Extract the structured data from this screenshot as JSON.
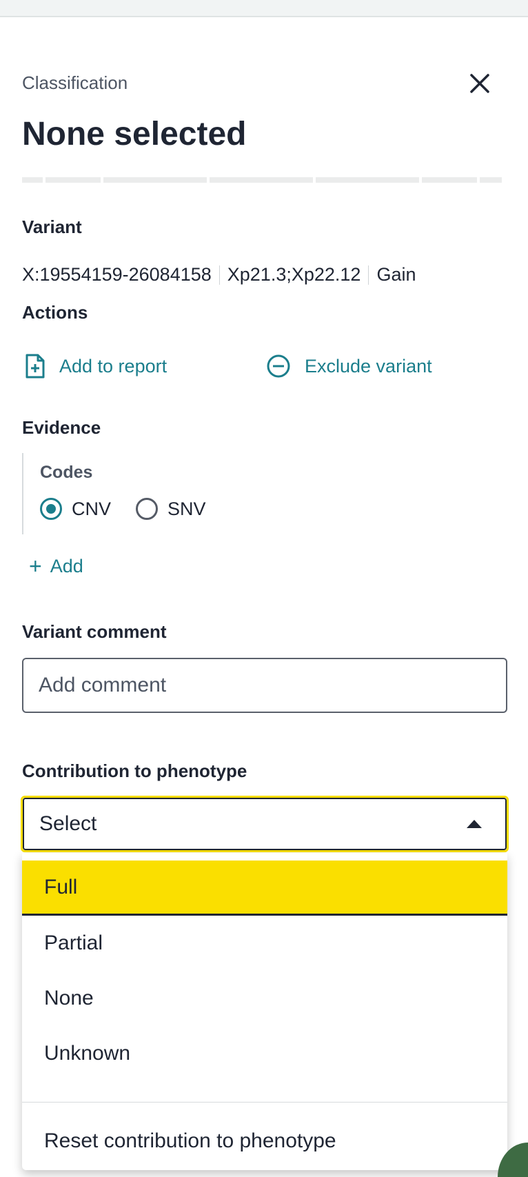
{
  "panel": {
    "eyebrow": "Classification",
    "title": "None selected",
    "close_icon": "close-icon"
  },
  "variant": {
    "label": "Variant",
    "coordinates": "X:19554159-26084158",
    "cytoband": "Xp21.3;Xp22.12",
    "type": "Gain"
  },
  "actions": {
    "label": "Actions",
    "add_to_report": "Add to report",
    "exclude_variant": "Exclude variant"
  },
  "evidence": {
    "label": "Evidence",
    "codes_label": "Codes",
    "options": [
      {
        "label": "CNV",
        "selected": true
      },
      {
        "label": "SNV",
        "selected": false
      }
    ],
    "add_label": "Add"
  },
  "comment": {
    "label": "Variant comment",
    "placeholder": "Add comment",
    "value": ""
  },
  "contribution": {
    "label": "Contribution to phenotype",
    "selected": "Select",
    "options": [
      "Full",
      "Partial",
      "None",
      "Unknown"
    ],
    "highlighted": "Full",
    "reset_label": "Reset contribution to phenotype"
  },
  "colors": {
    "accent": "#1b7e8c",
    "highlight": "#fadf00",
    "focus_ring": "#f6dd00",
    "text": "#1f2533"
  }
}
